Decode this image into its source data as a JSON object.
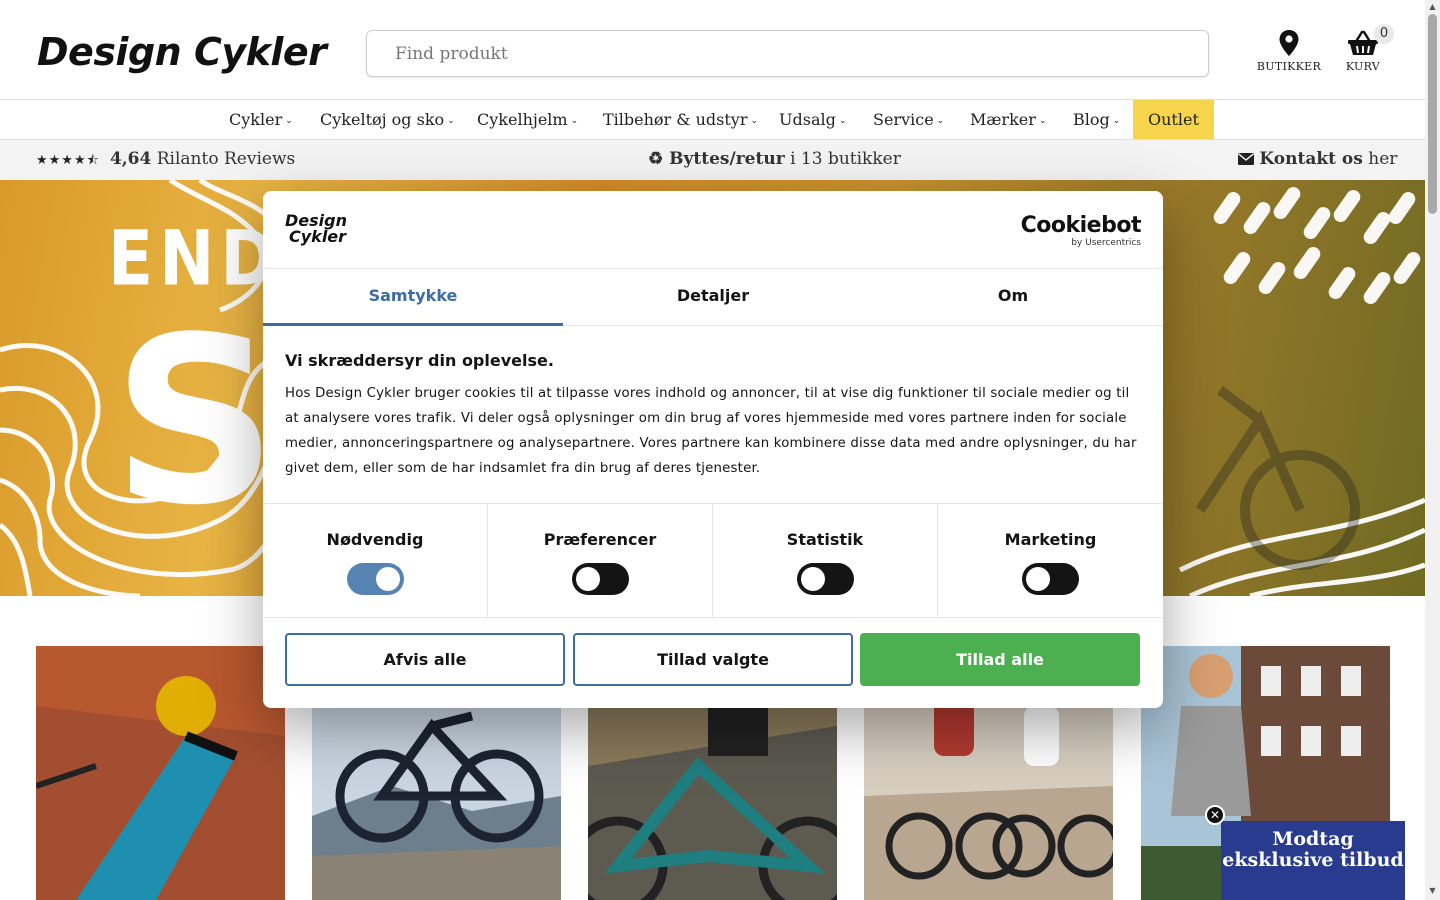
{
  "header": {
    "logo": "Design Cykler",
    "search_placeholder": "Find produkt",
    "stores_label": "BUTIKKER",
    "cart_label": "KURV",
    "cart_count": "0"
  },
  "nav": {
    "items": [
      "Cykler",
      "Cykeltøj og sko",
      "Cykelhjelm",
      "Tilbehør & udstyr",
      "Udsalg",
      "Service",
      "Mærker",
      "Blog"
    ],
    "outlet": "Outlet",
    "outlet_color": "#f6d44b"
  },
  "infobar": {
    "stars": "★★★★⯪",
    "rating": "4,64",
    "reviews": "Rilanto Reviews",
    "returns_bold": "♻ Byttes/retur",
    "returns_rest": "i 13 butikker",
    "contact_bold": "Kontakt os",
    "contact_rest": "her"
  },
  "hero": {
    "text_top": "END",
    "text_big": "S"
  },
  "dialog": {
    "logo_line1": "Design",
    "logo_line2": "Cykler",
    "provider": "Cookiebot",
    "provider_sub": "by Usercentrics",
    "tabs": [
      "Samtykke",
      "Detaljer",
      "Om"
    ],
    "heading": "Vi skræddersyr din oplevelse.",
    "body": "Hos Design Cykler bruger cookies til at tilpasse vores indhold og annoncer, til at vise dig funktioner til sociale medier og til at analysere vores trafik. Vi deler også oplysninger om din brug af vores hjemmeside med vores partnere inden for sociale medier, annonceringspartnere og analysepartnere. Vores partnere kan kombinere disse data med andre oplysninger, du har givet dem, eller som de har indsamlet fra din brug af deres tjenester.",
    "toggles": [
      {
        "label": "Nødvendig",
        "on": true
      },
      {
        "label": "Præferencer",
        "on": false
      },
      {
        "label": "Statistik",
        "on": false
      },
      {
        "label": "Marketing",
        "on": false
      }
    ],
    "buttons": {
      "reject": "Afvis alle",
      "allow_selected": "Tillad valgte",
      "allow_all": "Tillad alle"
    },
    "accent_color": "#3a6ea5",
    "allow_all_color": "#4caf50"
  },
  "promo": {
    "text": "Modtag eksklusive tilbud",
    "close": "✕",
    "color": "#293b8f"
  }
}
